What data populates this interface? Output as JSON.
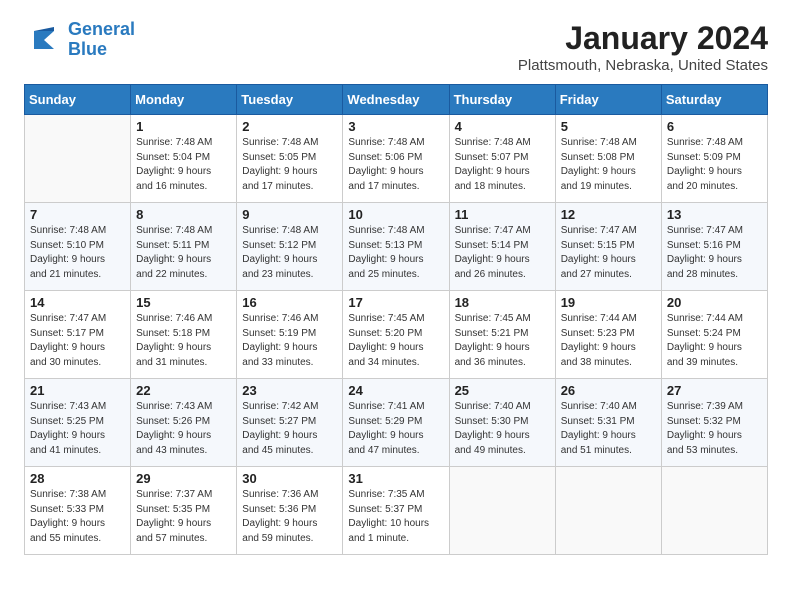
{
  "header": {
    "logo_line1": "General",
    "logo_line2": "Blue",
    "month": "January 2024",
    "location": "Plattsmouth, Nebraska, United States"
  },
  "days_of_week": [
    "Sunday",
    "Monday",
    "Tuesday",
    "Wednesday",
    "Thursday",
    "Friday",
    "Saturday"
  ],
  "weeks": [
    [
      {
        "day": "",
        "info": ""
      },
      {
        "day": "1",
        "info": "Sunrise: 7:48 AM\nSunset: 5:04 PM\nDaylight: 9 hours\nand 16 minutes."
      },
      {
        "day": "2",
        "info": "Sunrise: 7:48 AM\nSunset: 5:05 PM\nDaylight: 9 hours\nand 17 minutes."
      },
      {
        "day": "3",
        "info": "Sunrise: 7:48 AM\nSunset: 5:06 PM\nDaylight: 9 hours\nand 17 minutes."
      },
      {
        "day": "4",
        "info": "Sunrise: 7:48 AM\nSunset: 5:07 PM\nDaylight: 9 hours\nand 18 minutes."
      },
      {
        "day": "5",
        "info": "Sunrise: 7:48 AM\nSunset: 5:08 PM\nDaylight: 9 hours\nand 19 minutes."
      },
      {
        "day": "6",
        "info": "Sunrise: 7:48 AM\nSunset: 5:09 PM\nDaylight: 9 hours\nand 20 minutes."
      }
    ],
    [
      {
        "day": "7",
        "info": "Sunrise: 7:48 AM\nSunset: 5:10 PM\nDaylight: 9 hours\nand 21 minutes."
      },
      {
        "day": "8",
        "info": "Sunrise: 7:48 AM\nSunset: 5:11 PM\nDaylight: 9 hours\nand 22 minutes."
      },
      {
        "day": "9",
        "info": "Sunrise: 7:48 AM\nSunset: 5:12 PM\nDaylight: 9 hours\nand 23 minutes."
      },
      {
        "day": "10",
        "info": "Sunrise: 7:48 AM\nSunset: 5:13 PM\nDaylight: 9 hours\nand 25 minutes."
      },
      {
        "day": "11",
        "info": "Sunrise: 7:47 AM\nSunset: 5:14 PM\nDaylight: 9 hours\nand 26 minutes."
      },
      {
        "day": "12",
        "info": "Sunrise: 7:47 AM\nSunset: 5:15 PM\nDaylight: 9 hours\nand 27 minutes."
      },
      {
        "day": "13",
        "info": "Sunrise: 7:47 AM\nSunset: 5:16 PM\nDaylight: 9 hours\nand 28 minutes."
      }
    ],
    [
      {
        "day": "14",
        "info": "Sunrise: 7:47 AM\nSunset: 5:17 PM\nDaylight: 9 hours\nand 30 minutes."
      },
      {
        "day": "15",
        "info": "Sunrise: 7:46 AM\nSunset: 5:18 PM\nDaylight: 9 hours\nand 31 minutes."
      },
      {
        "day": "16",
        "info": "Sunrise: 7:46 AM\nSunset: 5:19 PM\nDaylight: 9 hours\nand 33 minutes."
      },
      {
        "day": "17",
        "info": "Sunrise: 7:45 AM\nSunset: 5:20 PM\nDaylight: 9 hours\nand 34 minutes."
      },
      {
        "day": "18",
        "info": "Sunrise: 7:45 AM\nSunset: 5:21 PM\nDaylight: 9 hours\nand 36 minutes."
      },
      {
        "day": "19",
        "info": "Sunrise: 7:44 AM\nSunset: 5:23 PM\nDaylight: 9 hours\nand 38 minutes."
      },
      {
        "day": "20",
        "info": "Sunrise: 7:44 AM\nSunset: 5:24 PM\nDaylight: 9 hours\nand 39 minutes."
      }
    ],
    [
      {
        "day": "21",
        "info": "Sunrise: 7:43 AM\nSunset: 5:25 PM\nDaylight: 9 hours\nand 41 minutes."
      },
      {
        "day": "22",
        "info": "Sunrise: 7:43 AM\nSunset: 5:26 PM\nDaylight: 9 hours\nand 43 minutes."
      },
      {
        "day": "23",
        "info": "Sunrise: 7:42 AM\nSunset: 5:27 PM\nDaylight: 9 hours\nand 45 minutes."
      },
      {
        "day": "24",
        "info": "Sunrise: 7:41 AM\nSunset: 5:29 PM\nDaylight: 9 hours\nand 47 minutes."
      },
      {
        "day": "25",
        "info": "Sunrise: 7:40 AM\nSunset: 5:30 PM\nDaylight: 9 hours\nand 49 minutes."
      },
      {
        "day": "26",
        "info": "Sunrise: 7:40 AM\nSunset: 5:31 PM\nDaylight: 9 hours\nand 51 minutes."
      },
      {
        "day": "27",
        "info": "Sunrise: 7:39 AM\nSunset: 5:32 PM\nDaylight: 9 hours\nand 53 minutes."
      }
    ],
    [
      {
        "day": "28",
        "info": "Sunrise: 7:38 AM\nSunset: 5:33 PM\nDaylight: 9 hours\nand 55 minutes."
      },
      {
        "day": "29",
        "info": "Sunrise: 7:37 AM\nSunset: 5:35 PM\nDaylight: 9 hours\nand 57 minutes."
      },
      {
        "day": "30",
        "info": "Sunrise: 7:36 AM\nSunset: 5:36 PM\nDaylight: 9 hours\nand 59 minutes."
      },
      {
        "day": "31",
        "info": "Sunrise: 7:35 AM\nSunset: 5:37 PM\nDaylight: 10 hours\nand 1 minute."
      },
      {
        "day": "",
        "info": ""
      },
      {
        "day": "",
        "info": ""
      },
      {
        "day": "",
        "info": ""
      }
    ]
  ],
  "accent_color": "#2a7abf"
}
